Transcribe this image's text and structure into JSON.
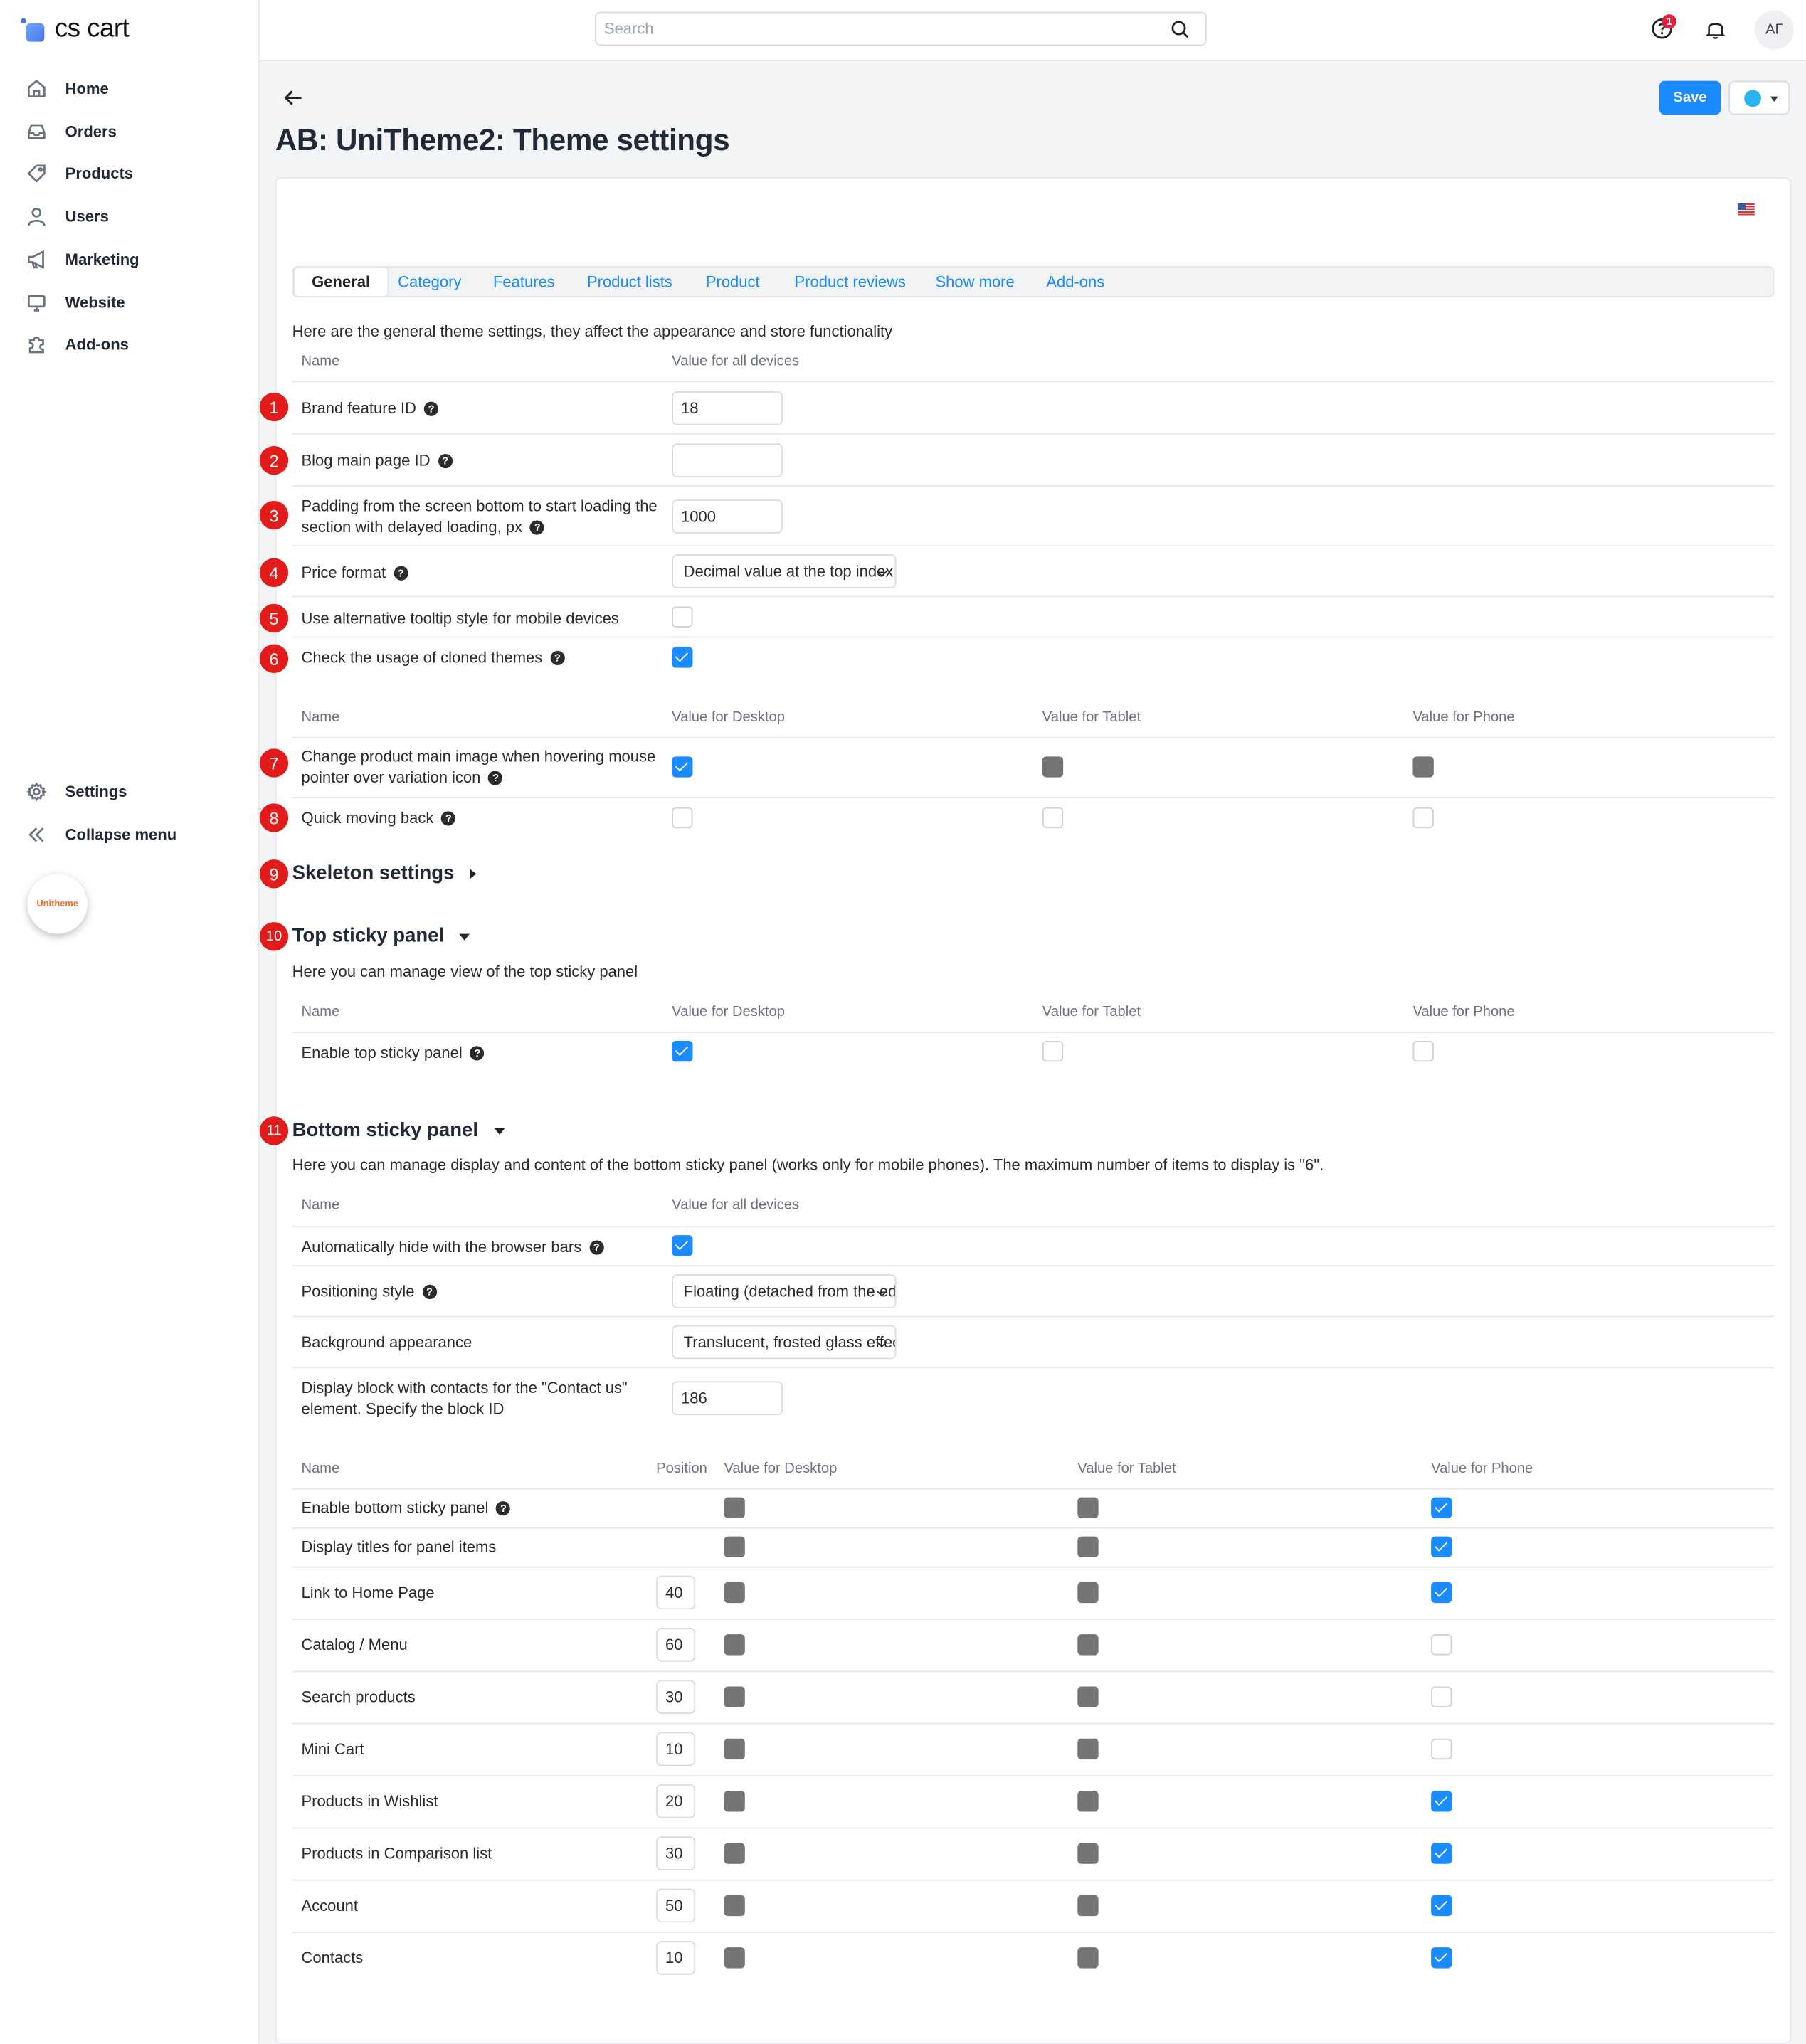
{
  "app": {
    "logo": "cs cart"
  },
  "sidebar": {
    "items": [
      {
        "label": "Home",
        "icon": "home-icon"
      },
      {
        "label": "Orders",
        "icon": "inbox-icon"
      },
      {
        "label": "Products",
        "icon": "tag-icon"
      },
      {
        "label": "Users",
        "icon": "user-icon"
      },
      {
        "label": "Marketing",
        "icon": "megaphone-icon"
      },
      {
        "label": "Website",
        "icon": "monitor-icon"
      },
      {
        "label": "Add-ons",
        "icon": "puzzle-icon"
      }
    ],
    "settings": "Settings",
    "collapse": "Collapse menu",
    "badge": "Unitheme"
  },
  "topbar": {
    "search_placeholder": "Search",
    "notification_count": "1",
    "avatar": "АГ"
  },
  "header": {
    "title": "AB: UniTheme2: Theme settings",
    "save": "Save"
  },
  "tabs": [
    "General",
    "Category",
    "Features",
    "Product lists",
    "Product",
    "Product reviews",
    "Show more",
    "Add-ons"
  ],
  "general": {
    "intro": "Here are the general theme settings, they affect the appearance and store functionality",
    "col_name": "Name",
    "col_value_all": "Value for all devices",
    "rows": [
      {
        "marker": "1",
        "label": "Brand feature ID",
        "value": "18"
      },
      {
        "marker": "2",
        "label": "Blog main page ID",
        "value": ""
      },
      {
        "marker": "3",
        "label_line1": "Padding from the screen bottom to start loading the",
        "label_line2": "section with delayed loading, px",
        "value": "1000"
      },
      {
        "marker": "4",
        "label": "Price format",
        "value": "Decimal value at the top index"
      },
      {
        "marker": "5",
        "label": "Use alternative tooltip style for mobile devices",
        "checked": false
      },
      {
        "marker": "6",
        "label": "Check the usage of cloned themes",
        "checked": true
      }
    ],
    "device_cols": {
      "name": "Name",
      "desktop": "Value for Desktop",
      "tablet": "Value for Tablet",
      "phone": "Value for Phone"
    },
    "device_rows": [
      {
        "marker": "7",
        "label_line1": "Change product main image when hovering mouse",
        "label_line2": "pointer over variation icon",
        "desktop": "checked",
        "tablet": "disabled",
        "phone": "disabled"
      },
      {
        "marker": "8",
        "label": "Quick moving back",
        "desktop": "unchecked",
        "tablet": "unchecked",
        "phone": "unchecked"
      }
    ]
  },
  "skeleton": {
    "marker": "9",
    "title": "Skeleton settings"
  },
  "top_sticky": {
    "marker": "10",
    "title": "Top sticky panel",
    "intro": "Here you can manage view of the top sticky panel",
    "cols": {
      "name": "Name",
      "desktop": "Value for Desktop",
      "tablet": "Value for Tablet",
      "phone": "Value for Phone"
    },
    "row": {
      "label": "Enable top sticky panel",
      "desktop": "checked",
      "tablet": "unchecked",
      "phone": "unchecked"
    }
  },
  "bottom_sticky": {
    "marker": "11",
    "title": "Bottom sticky panel",
    "intro": "Here you can manage display and content of the bottom sticky panel (works only for mobile phones). The maximum number of items to display is \"6\".",
    "col_name": "Name",
    "col_value_all": "Value for all devices",
    "settings": [
      {
        "label": "Automatically hide with the browser bars",
        "checked": true
      },
      {
        "label": "Positioning style",
        "value": "Floating (detached from the edges)"
      },
      {
        "label": "Background appearance",
        "value": "Translucent, frosted glass effect"
      },
      {
        "label_line1": "Display block with contacts for the \"Contact us\"",
        "label_line2": "element. Specify the block ID",
        "value": "186"
      }
    ],
    "items_cols": {
      "name": "Name",
      "position": "Position",
      "desktop": "Value for Desktop",
      "tablet": "Value for Tablet",
      "phone": "Value for Phone"
    },
    "items": [
      {
        "label": "Enable bottom sticky panel",
        "help": true,
        "position": "",
        "desktop": "disabled",
        "tablet": "disabled",
        "phone": "checked"
      },
      {
        "label": "Display titles for panel items",
        "position": "",
        "desktop": "disabled",
        "tablet": "disabled",
        "phone": "checked"
      },
      {
        "label": "Link to Home Page",
        "position": "40",
        "desktop": "disabled",
        "tablet": "disabled",
        "phone": "checked"
      },
      {
        "label": "Catalog / Menu",
        "position": "60",
        "desktop": "disabled",
        "tablet": "disabled",
        "phone": "unchecked"
      },
      {
        "label": "Search products",
        "position": "30",
        "desktop": "disabled",
        "tablet": "disabled",
        "phone": "unchecked"
      },
      {
        "label": "Mini Cart",
        "position": "10",
        "desktop": "disabled",
        "tablet": "disabled",
        "phone": "unchecked"
      },
      {
        "label": "Products in Wishlist",
        "position": "20",
        "desktop": "disabled",
        "tablet": "disabled",
        "phone": "checked"
      },
      {
        "label": "Products in Comparison list",
        "position": "30",
        "desktop": "disabled",
        "tablet": "disabled",
        "phone": "checked"
      },
      {
        "label": "Account",
        "position": "50",
        "desktop": "disabled",
        "tablet": "disabled",
        "phone": "checked"
      },
      {
        "label": "Contacts",
        "position": "10",
        "desktop": "disabled",
        "tablet": "disabled",
        "phone": "checked"
      }
    ]
  },
  "colors": {
    "accent": "#1a8cff",
    "marker": "#e21b1b",
    "disabled": "#757575"
  }
}
